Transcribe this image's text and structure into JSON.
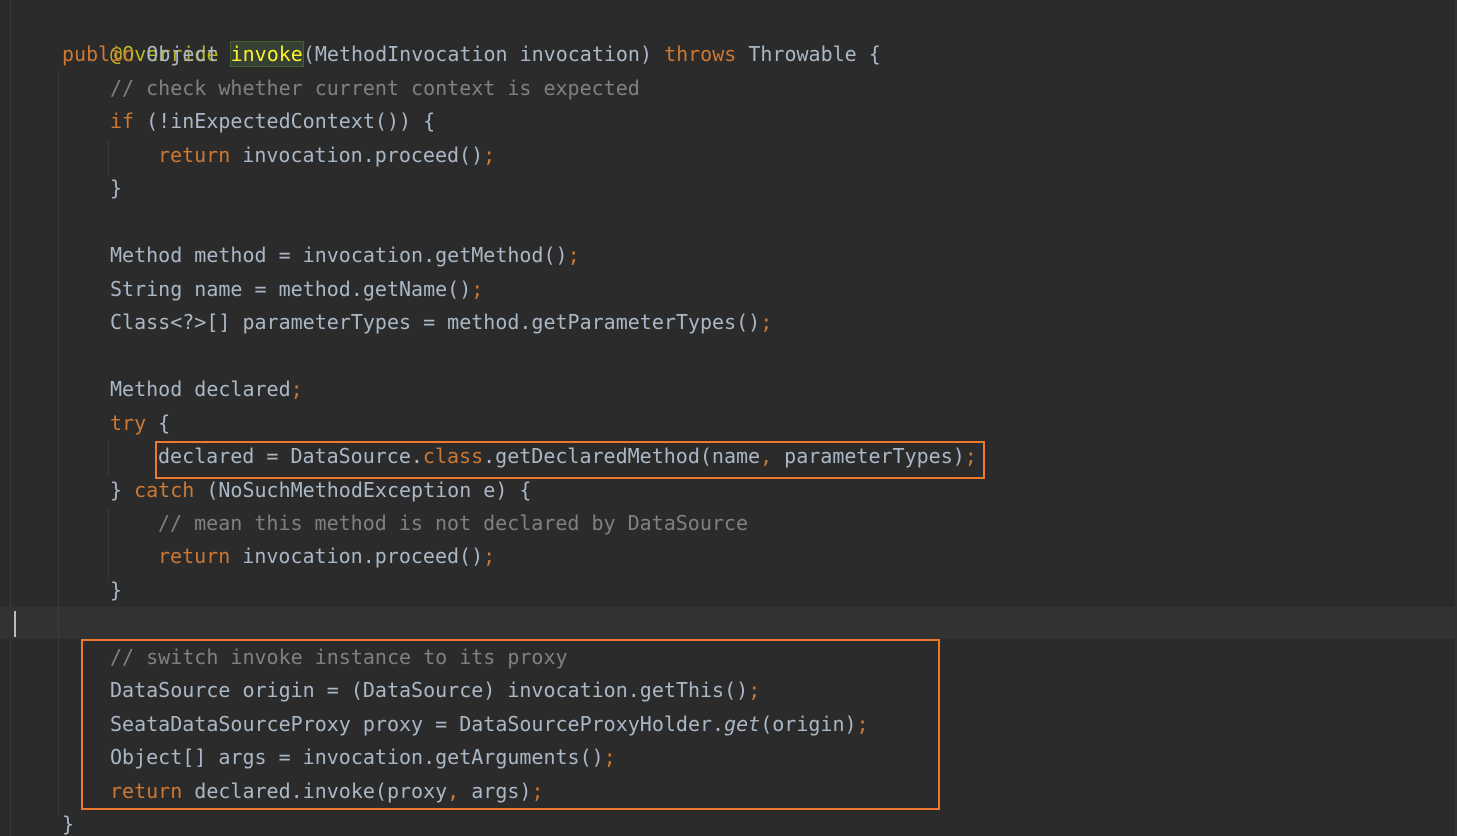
{
  "editor": {
    "language": "java",
    "colors": {
      "background": "#2b2b2b",
      "keyword": "#cc7832",
      "annotation": "#bbb529",
      "comment": "#808080",
      "text": "#a9b7c6",
      "highlight_box": "#f0782d"
    },
    "code": {
      "l1": {
        "ann": "@Override"
      },
      "l2": {
        "kw1": "public",
        "t1": " Object ",
        "method": "invoke",
        "t2": "(MethodInvocation invocation) ",
        "kw2": "throws",
        "t3": " Throwable {"
      },
      "l3": {
        "comment": "// check whether current context is expected"
      },
      "l4": {
        "kw": "if",
        "t1": " (!inExpectedContext()) {"
      },
      "l5": {
        "kw": "return",
        "t1": " invocation.proceed()",
        "semi": ";"
      },
      "l6": {
        "t1": "}"
      },
      "l7": {
        "t1": "Method method = invocation.getMethod()",
        "semi": ";"
      },
      "l8": {
        "t1": "String name = method.getName()",
        "semi": ";"
      },
      "l9": {
        "t1": "Class<?>[] parameterTypes = method.getParameterTypes()",
        "semi": ";"
      },
      "l10": {
        "t1": "Method declared",
        "semi": ";"
      },
      "l11": {
        "kw": "try",
        "t1": " {"
      },
      "l12": {
        "t1": "declared = DataSource.",
        "kw": "class",
        "t2": ".getDeclaredMethod(name",
        "comma": ",",
        "t3": " parameterTypes)",
        "semi": ";"
      },
      "l13": {
        "t0": "} ",
        "kw": "catch",
        "t1": " (NoSuchMethodException e) {"
      },
      "l14": {
        "comment": "// mean this method is not declared by DataSource"
      },
      "l15": {
        "kw": "return",
        "t1": " invocation.proceed()",
        "semi": ";"
      },
      "l16": {
        "t1": "}"
      },
      "l17": {
        "comment": "// switch invoke instance to its proxy"
      },
      "l18": {
        "t1": "DataSource origin = (DataSource) invocation.getThis()",
        "semi": ";"
      },
      "l19": {
        "t1": "SeataDataSourceProxy proxy = DataSourceProxyHolder.",
        "italic": "get",
        "t2": "(origin)",
        "semi": ";"
      },
      "l20": {
        "t1": "Object[] args = invocation.getArguments()",
        "semi": ";"
      },
      "l21": {
        "kw": "return",
        "t1": " declared.invoke(proxy",
        "comma": ",",
        "t2": " args)",
        "semi": ";"
      },
      "l22": {
        "t1": "}"
      }
    }
  }
}
